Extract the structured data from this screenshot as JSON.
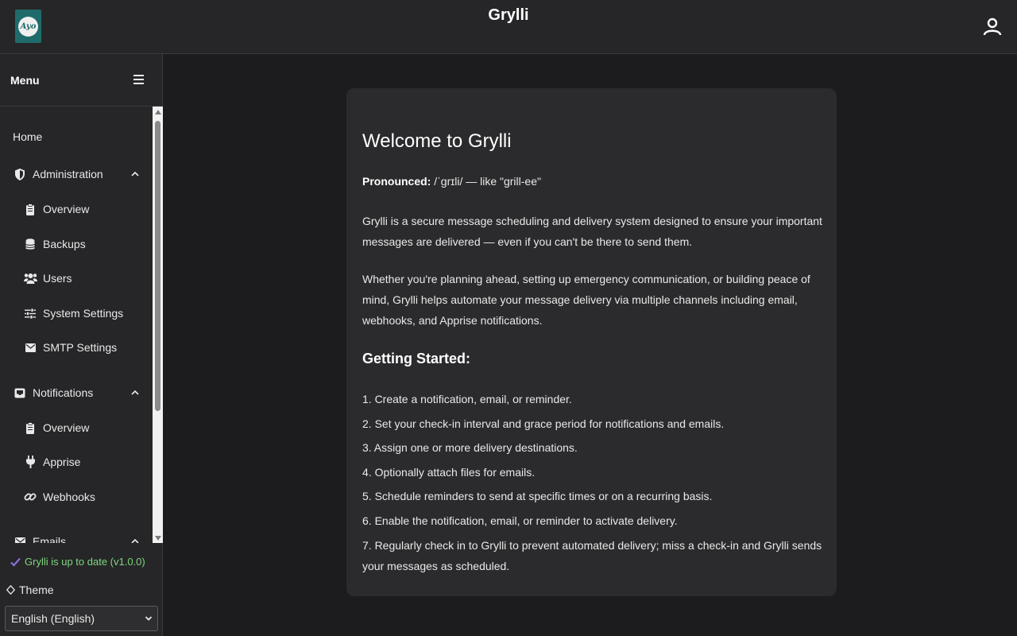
{
  "header": {
    "app_title": "Grylli",
    "logo_text": "Ayo",
    "user_icon": "user-icon"
  },
  "sidebar": {
    "menu_title": "Menu",
    "items": [
      {
        "label": "Home",
        "icon": "none",
        "level": 0
      },
      {
        "label": "Administration",
        "icon": "shield-icon",
        "level": 0,
        "expanded": true
      },
      {
        "label": "Overview",
        "icon": "clipboard-icon",
        "level": 1
      },
      {
        "label": "Backups",
        "icon": "database-icon",
        "level": 1
      },
      {
        "label": "Users",
        "icon": "users-icon",
        "level": 1
      },
      {
        "label": "System Settings",
        "icon": "sliders-icon",
        "level": 1
      },
      {
        "label": "SMTP Settings",
        "icon": "envelope-icon",
        "level": 1
      },
      {
        "label": "Notifications",
        "icon": "inbox-icon",
        "level": 0,
        "expanded": true
      },
      {
        "label": "Overview",
        "icon": "clipboard-icon",
        "level": 1
      },
      {
        "label": "Apprise",
        "icon": "plug-icon",
        "level": 1
      },
      {
        "label": "Webhooks",
        "icon": "link-icon",
        "level": 1
      },
      {
        "label": "Emails",
        "icon": "envelope-icon",
        "level": 0,
        "expanded": true
      }
    ],
    "update_status": "Grylli is up to date (v1.0.0)",
    "theme_label": "Theme",
    "language_selected": "English (English)"
  },
  "content": {
    "title": "Welcome to Grylli",
    "pronounced_label": "Pronounced:",
    "pronounced_value": "/ˈɡrɪli/ — like \"grill-ee\"",
    "para1": "Grylli is a secure message scheduling and delivery system designed to ensure your important messages are delivered — even if you can't be there to send them.",
    "para2": "Whether you're planning ahead, setting up emergency communication, or building peace of mind, Grylli helps automate your message delivery via multiple channels including email, webhooks, and Apprise notifications.",
    "getting_started_title": "Getting Started:",
    "steps": [
      "1. Create a notification, email, or reminder.",
      "2. Set your check-in interval and grace period for notifications and emails.",
      "3. Assign one or more delivery destinations.",
      "4. Optionally attach files for emails.",
      "5. Schedule reminders to send at specific times or on a recurring basis.",
      "6. Enable the notification, email, or reminder to activate delivery.",
      "7. Regularly check in to Grylli to prevent automated delivery; miss a check-in and Grylli sends your messages as scheduled."
    ]
  },
  "colors": {
    "background": "#1c1c1e",
    "surface": "#262628",
    "card": "#2b2b2d",
    "success": "#7fd67f",
    "logo_bg": "#1f6b6b"
  }
}
